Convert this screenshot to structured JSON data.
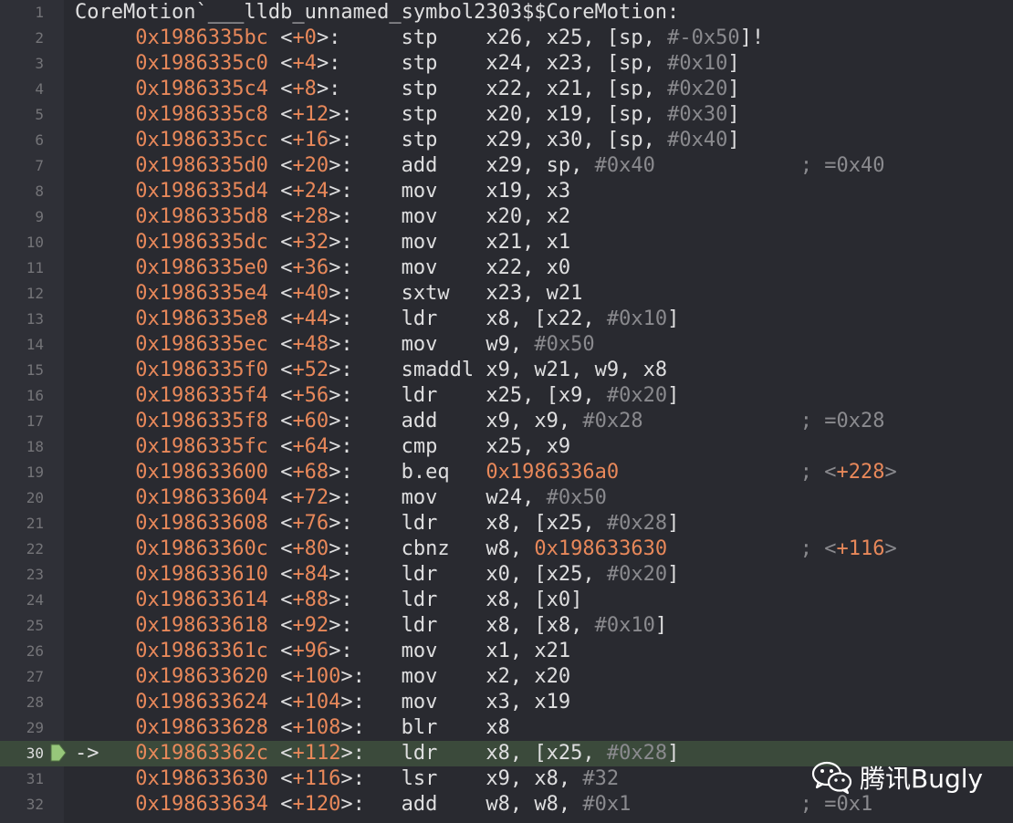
{
  "header": {
    "number": "1",
    "symbol": "CoreMotion`___lldb_unnamed_symbol2303$$CoreMotion:"
  },
  "current_line": 30,
  "pc_arrow": "->",
  "colors": {
    "background": "#292a30",
    "gutter": "#2f3037",
    "highlight": "#3b4a3b",
    "address": "#e8885a",
    "text": "#dfdfe0",
    "immediate": "#8a8a8e"
  },
  "instructions": [
    {
      "n": "2",
      "addr": "0x1986335bc",
      "off": "+0",
      "mn": "stp",
      "ops": [
        [
          "x26, x25, [sp, ",
          "t"
        ],
        [
          "#-0x50",
          "i"
        ],
        [
          "]!",
          "t"
        ]
      ],
      "cm": []
    },
    {
      "n": "3",
      "addr": "0x1986335c0",
      "off": "+4",
      "mn": "stp",
      "ops": [
        [
          "x24, x23, [sp, ",
          "t"
        ],
        [
          "#0x10",
          "i"
        ],
        [
          "]",
          "t"
        ]
      ],
      "cm": []
    },
    {
      "n": "4",
      "addr": "0x1986335c4",
      "off": "+8",
      "mn": "stp",
      "ops": [
        [
          "x22, x21, [sp, ",
          "t"
        ],
        [
          "#0x20",
          "i"
        ],
        [
          "]",
          "t"
        ]
      ],
      "cm": []
    },
    {
      "n": "5",
      "addr": "0x1986335c8",
      "off": "+12",
      "mn": "stp",
      "ops": [
        [
          "x20, x19, [sp, ",
          "t"
        ],
        [
          "#0x30",
          "i"
        ],
        [
          "]",
          "t"
        ]
      ],
      "cm": []
    },
    {
      "n": "6",
      "addr": "0x1986335cc",
      "off": "+16",
      "mn": "stp",
      "ops": [
        [
          "x29, x30, [sp, ",
          "t"
        ],
        [
          "#0x40",
          "i"
        ],
        [
          "]",
          "t"
        ]
      ],
      "cm": []
    },
    {
      "n": "7",
      "addr": "0x1986335d0",
      "off": "+20",
      "mn": "add",
      "ops": [
        [
          "x29, sp, ",
          "t"
        ],
        [
          "#0x40",
          "i"
        ]
      ],
      "cm": [
        [
          "; =0x40",
          "c"
        ]
      ]
    },
    {
      "n": "8",
      "addr": "0x1986335d4",
      "off": "+24",
      "mn": "mov",
      "ops": [
        [
          "x19, x3",
          "t"
        ]
      ],
      "cm": []
    },
    {
      "n": "9",
      "addr": "0x1986335d8",
      "off": "+28",
      "mn": "mov",
      "ops": [
        [
          "x20, x2",
          "t"
        ]
      ],
      "cm": []
    },
    {
      "n": "10",
      "addr": "0x1986335dc",
      "off": "+32",
      "mn": "mov",
      "ops": [
        [
          "x21, x1",
          "t"
        ]
      ],
      "cm": []
    },
    {
      "n": "11",
      "addr": "0x1986335e0",
      "off": "+36",
      "mn": "mov",
      "ops": [
        [
          "x22, x0",
          "t"
        ]
      ],
      "cm": []
    },
    {
      "n": "12",
      "addr": "0x1986335e4",
      "off": "+40",
      "mn": "sxtw",
      "ops": [
        [
          "x23, w21",
          "t"
        ]
      ],
      "cm": []
    },
    {
      "n": "13",
      "addr": "0x1986335e8",
      "off": "+44",
      "mn": "ldr",
      "ops": [
        [
          "x8, [x22, ",
          "t"
        ],
        [
          "#0x10",
          "i"
        ],
        [
          "]",
          "t"
        ]
      ],
      "cm": []
    },
    {
      "n": "14",
      "addr": "0x1986335ec",
      "off": "+48",
      "mn": "mov",
      "ops": [
        [
          "w9, ",
          "t"
        ],
        [
          "#0x50",
          "i"
        ]
      ],
      "cm": []
    },
    {
      "n": "15",
      "addr": "0x1986335f0",
      "off": "+52",
      "mn": "smaddl",
      "ops": [
        [
          "x9, w21, w9, x8",
          "t"
        ]
      ],
      "cm": []
    },
    {
      "n": "16",
      "addr": "0x1986335f4",
      "off": "+56",
      "mn": "ldr",
      "ops": [
        [
          "x25, [x9, ",
          "t"
        ],
        [
          "#0x20",
          "i"
        ],
        [
          "]",
          "t"
        ]
      ],
      "cm": []
    },
    {
      "n": "17",
      "addr": "0x1986335f8",
      "off": "+60",
      "mn": "add",
      "ops": [
        [
          "x9, x9, ",
          "t"
        ],
        [
          "#0x28",
          "i"
        ]
      ],
      "cm": [
        [
          "; =0x28",
          "c"
        ]
      ]
    },
    {
      "n": "18",
      "addr": "0x1986335fc",
      "off": "+64",
      "mn": "cmp",
      "ops": [
        [
          "x25, x9",
          "t"
        ]
      ],
      "cm": []
    },
    {
      "n": "19",
      "addr": "0x198633600",
      "off": "+68",
      "mn": "b.eq",
      "ops": [
        [
          "0x1986336a0",
          "a"
        ]
      ],
      "cm": [
        [
          "; <",
          "c"
        ],
        [
          "+228",
          "o"
        ],
        [
          ">",
          "c"
        ]
      ]
    },
    {
      "n": "20",
      "addr": "0x198633604",
      "off": "+72",
      "mn": "mov",
      "ops": [
        [
          "w24, ",
          "t"
        ],
        [
          "#0x50",
          "i"
        ]
      ],
      "cm": []
    },
    {
      "n": "21",
      "addr": "0x198633608",
      "off": "+76",
      "mn": "ldr",
      "ops": [
        [
          "x8, [x25, ",
          "t"
        ],
        [
          "#0x28",
          "i"
        ],
        [
          "]",
          "t"
        ]
      ],
      "cm": []
    },
    {
      "n": "22",
      "addr": "0x19863360c",
      "off": "+80",
      "mn": "cbnz",
      "ops": [
        [
          "w8, ",
          "t"
        ],
        [
          "0x198633630",
          "a"
        ]
      ],
      "cm": [
        [
          "; <",
          "c"
        ],
        [
          "+116",
          "o"
        ],
        [
          ">",
          "c"
        ]
      ]
    },
    {
      "n": "23",
      "addr": "0x198633610",
      "off": "+84",
      "mn": "ldr",
      "ops": [
        [
          "x0, [x25, ",
          "t"
        ],
        [
          "#0x20",
          "i"
        ],
        [
          "]",
          "t"
        ]
      ],
      "cm": []
    },
    {
      "n": "24",
      "addr": "0x198633614",
      "off": "+88",
      "mn": "ldr",
      "ops": [
        [
          "x8, [x0]",
          "t"
        ]
      ],
      "cm": []
    },
    {
      "n": "25",
      "addr": "0x198633618",
      "off": "+92",
      "mn": "ldr",
      "ops": [
        [
          "x8, [x8, ",
          "t"
        ],
        [
          "#0x10",
          "i"
        ],
        [
          "]",
          "t"
        ]
      ],
      "cm": []
    },
    {
      "n": "26",
      "addr": "0x19863361c",
      "off": "+96",
      "mn": "mov",
      "ops": [
        [
          "x1, x21",
          "t"
        ]
      ],
      "cm": []
    },
    {
      "n": "27",
      "addr": "0x198633620",
      "off": "+100",
      "mn": "mov",
      "ops": [
        [
          "x2, x20",
          "t"
        ]
      ],
      "cm": []
    },
    {
      "n": "28",
      "addr": "0x198633624",
      "off": "+104",
      "mn": "mov",
      "ops": [
        [
          "x3, x19",
          "t"
        ]
      ],
      "cm": []
    },
    {
      "n": "29",
      "addr": "0x198633628",
      "off": "+108",
      "mn": "blr",
      "ops": [
        [
          "x8",
          "t"
        ]
      ],
      "cm": []
    },
    {
      "n": "30",
      "addr": "0x19863362c",
      "off": "+112",
      "mn": "ldr",
      "ops": [
        [
          "x8, [x25, ",
          "t"
        ],
        [
          "#0x28",
          "i"
        ],
        [
          "]",
          "t"
        ]
      ],
      "cm": []
    },
    {
      "n": "31",
      "addr": "0x198633630",
      "off": "+116",
      "mn": "lsr",
      "ops": [
        [
          "x9, x8, ",
          "t"
        ],
        [
          "#32",
          "i"
        ]
      ],
      "cm": []
    },
    {
      "n": "32",
      "addr": "0x198633634",
      "off": "+120",
      "mn": "add",
      "ops": [
        [
          "w8, w8, ",
          "t"
        ],
        [
          "#0x1",
          "i"
        ]
      ],
      "cm": [
        [
          "; =0x1",
          "c"
        ]
      ]
    }
  ],
  "watermark": {
    "text": "腾讯Bugly",
    "icon": "wechat-icon"
  }
}
